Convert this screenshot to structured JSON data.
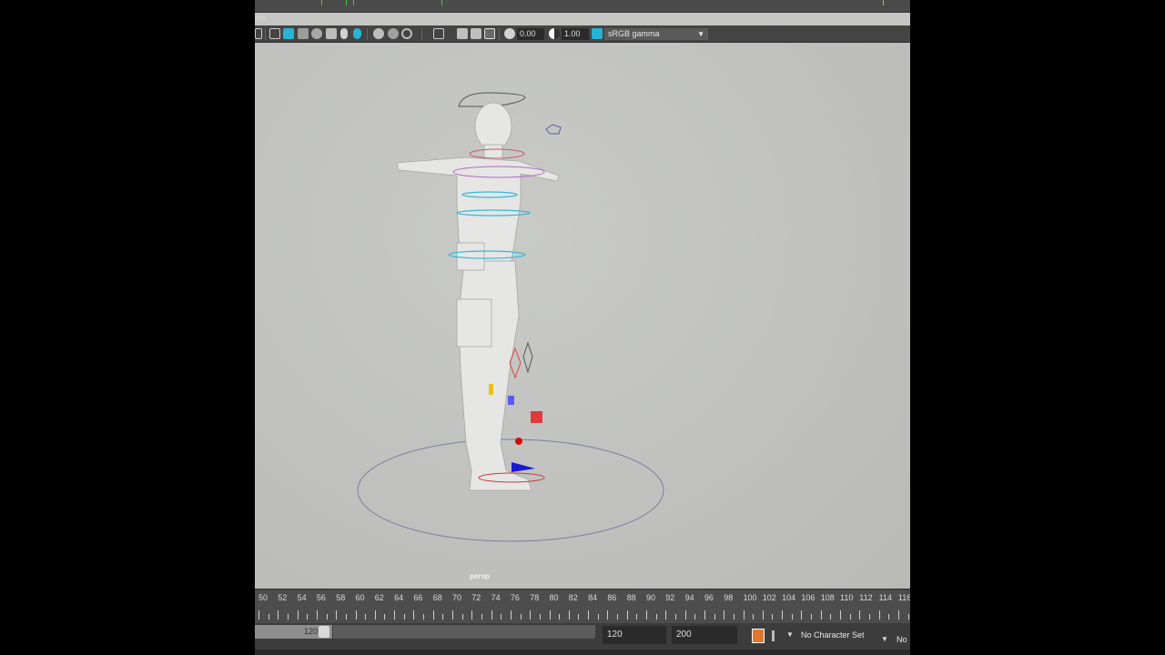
{
  "menu": {
    "panels_label": "els"
  },
  "toolbar": {
    "exposure_value": "0.00",
    "gamma_value": "1.00",
    "color_space": "sRGB gamma",
    "icons": [
      "camera-icon",
      "cube-wireframe-icon",
      "cube-shaded-icon",
      "cube-textured-icon",
      "sphere-icon",
      "light-icon",
      "shadow-icon",
      "ambient-occlusion-icon",
      "motion-blur-icon",
      "antialias-icon",
      "frame-all-icon",
      "grid-icon",
      "isolate-icon",
      "xray-icon",
      "exposure-icon",
      "gamma-icon",
      "color-management-icon"
    ]
  },
  "viewport": {
    "camera_label": "persp"
  },
  "timeline": {
    "ticks": [
      "50",
      "52",
      "54",
      "56",
      "58",
      "60",
      "62",
      "64",
      "66",
      "68",
      "70",
      "72",
      "74",
      "76",
      "78",
      "80",
      "82",
      "84",
      "86",
      "88",
      "90",
      "92",
      "94",
      "96",
      "98",
      "100",
      "102",
      "104",
      "106",
      "108",
      "110",
      "112",
      "114",
      "116"
    ]
  },
  "range": {
    "slider_end": "120",
    "end_time": "120",
    "max_time": "200",
    "character_set": "No Character Set",
    "anim_layer": "No"
  },
  "colors": {
    "viewport_bg": "#c6c6c4",
    "ui_dark": "#444444",
    "accent_cyan": "#27b4d6"
  }
}
